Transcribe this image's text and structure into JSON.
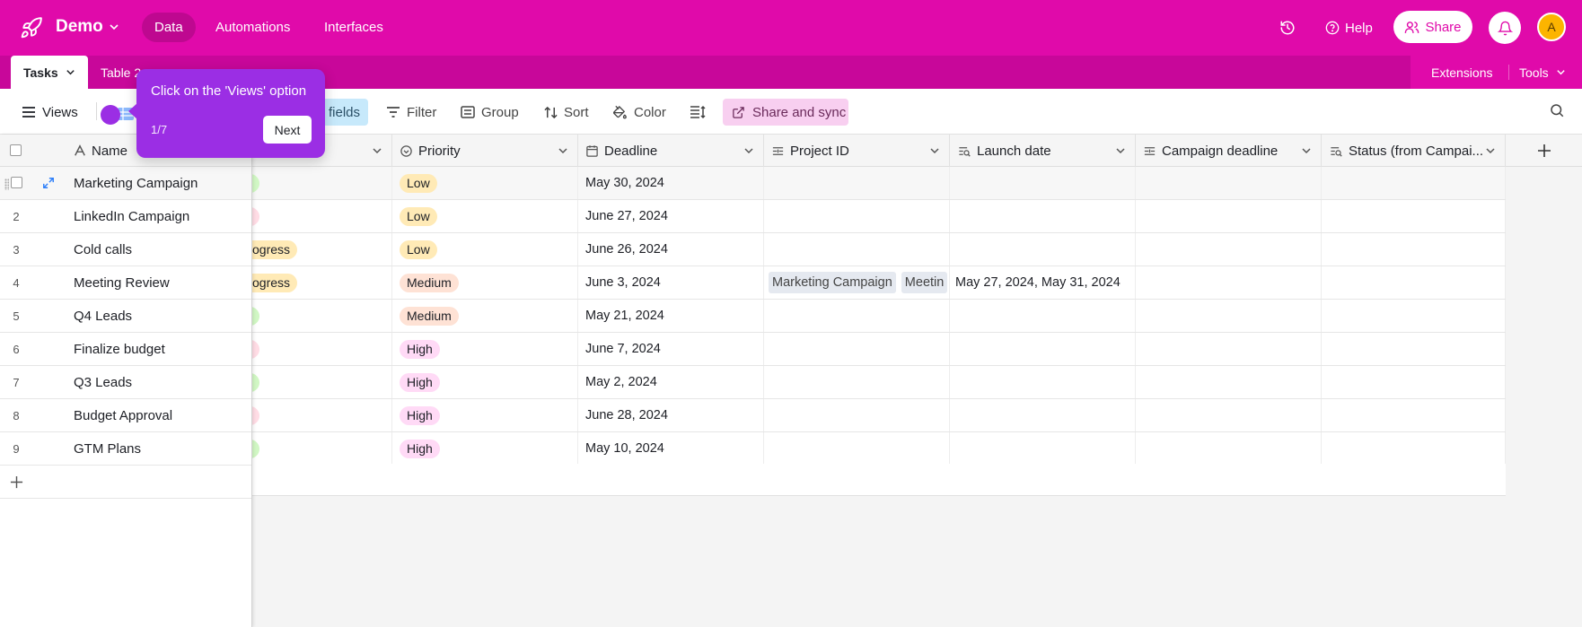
{
  "topbar": {
    "base_name": "Demo",
    "nav": [
      "Data",
      "Automations",
      "Interfaces"
    ],
    "help_label": "Help",
    "share_label": "Share",
    "avatar_initial": "A"
  },
  "tabbar": {
    "active_tab": "Tasks",
    "other_tab": "Table 2",
    "extensions_label": "Extensions",
    "tools_label": "Tools"
  },
  "viewbar": {
    "views_label": "Views",
    "hidden_fields_label": "fields",
    "filter_label": "Filter",
    "group_label": "Group",
    "sort_label": "Sort",
    "color_label": "Color",
    "share_sync_label": "Share and sync"
  },
  "tooltip": {
    "text": "Click on the 'Views' option",
    "step": "1/7",
    "next_label": "Next"
  },
  "columns": {
    "name": "Name",
    "priority": "Priority",
    "deadline": "Deadline",
    "project_id": "Project ID",
    "launch_date": "Launch date",
    "campaign_deadline": "Campaign deadline",
    "status_from_campaign": "Status (from Campai..."
  },
  "rows": [
    {
      "num": "1",
      "name": "Marketing Campaign",
      "status": "",
      "status_color": "green",
      "priority": "Low",
      "priority_class": "low",
      "deadline": "May 30, 2024"
    },
    {
      "num": "2",
      "name": "LinkedIn Campaign",
      "status": "",
      "status_color": "pink",
      "priority": "Low",
      "priority_class": "low",
      "deadline": "June 27, 2024"
    },
    {
      "num": "3",
      "name": "Cold calls",
      "status": "ogress",
      "status_color": "yellow",
      "priority": "Low",
      "priority_class": "low",
      "deadline": "June 26, 2024"
    },
    {
      "num": "4",
      "name": "Meeting Review",
      "status": "ogress",
      "status_color": "yellow",
      "priority": "Medium",
      "priority_class": "medium",
      "deadline": "June 3, 2024",
      "project_ids": [
        "Marketing Campaign",
        "Meetin"
      ],
      "launch_date": "May 27, 2024, May 31, 2024"
    },
    {
      "num": "5",
      "name": "Q4 Leads",
      "status": "",
      "status_color": "green",
      "priority": "Medium",
      "priority_class": "medium",
      "deadline": "May 21, 2024"
    },
    {
      "num": "6",
      "name": "Finalize budget",
      "status": "",
      "status_color": "pink",
      "priority": "High",
      "priority_class": "high",
      "deadline": "June 7, 2024"
    },
    {
      "num": "7",
      "name": "Q3 Leads",
      "status": "",
      "status_color": "green",
      "priority": "High",
      "priority_class": "high",
      "deadline": "May 2, 2024"
    },
    {
      "num": "8",
      "name": "Budget Approval",
      "status": "",
      "status_color": "pink",
      "priority": "High",
      "priority_class": "high",
      "deadline": "June 28, 2024"
    },
    {
      "num": "9",
      "name": "GTM Plans",
      "status": "",
      "status_color": "green",
      "priority": "High",
      "priority_class": "high",
      "deadline": "May 10, 2024"
    }
  ],
  "colors": {
    "brand": "#e00aaa",
    "tooltip": "#9b2ee4"
  }
}
